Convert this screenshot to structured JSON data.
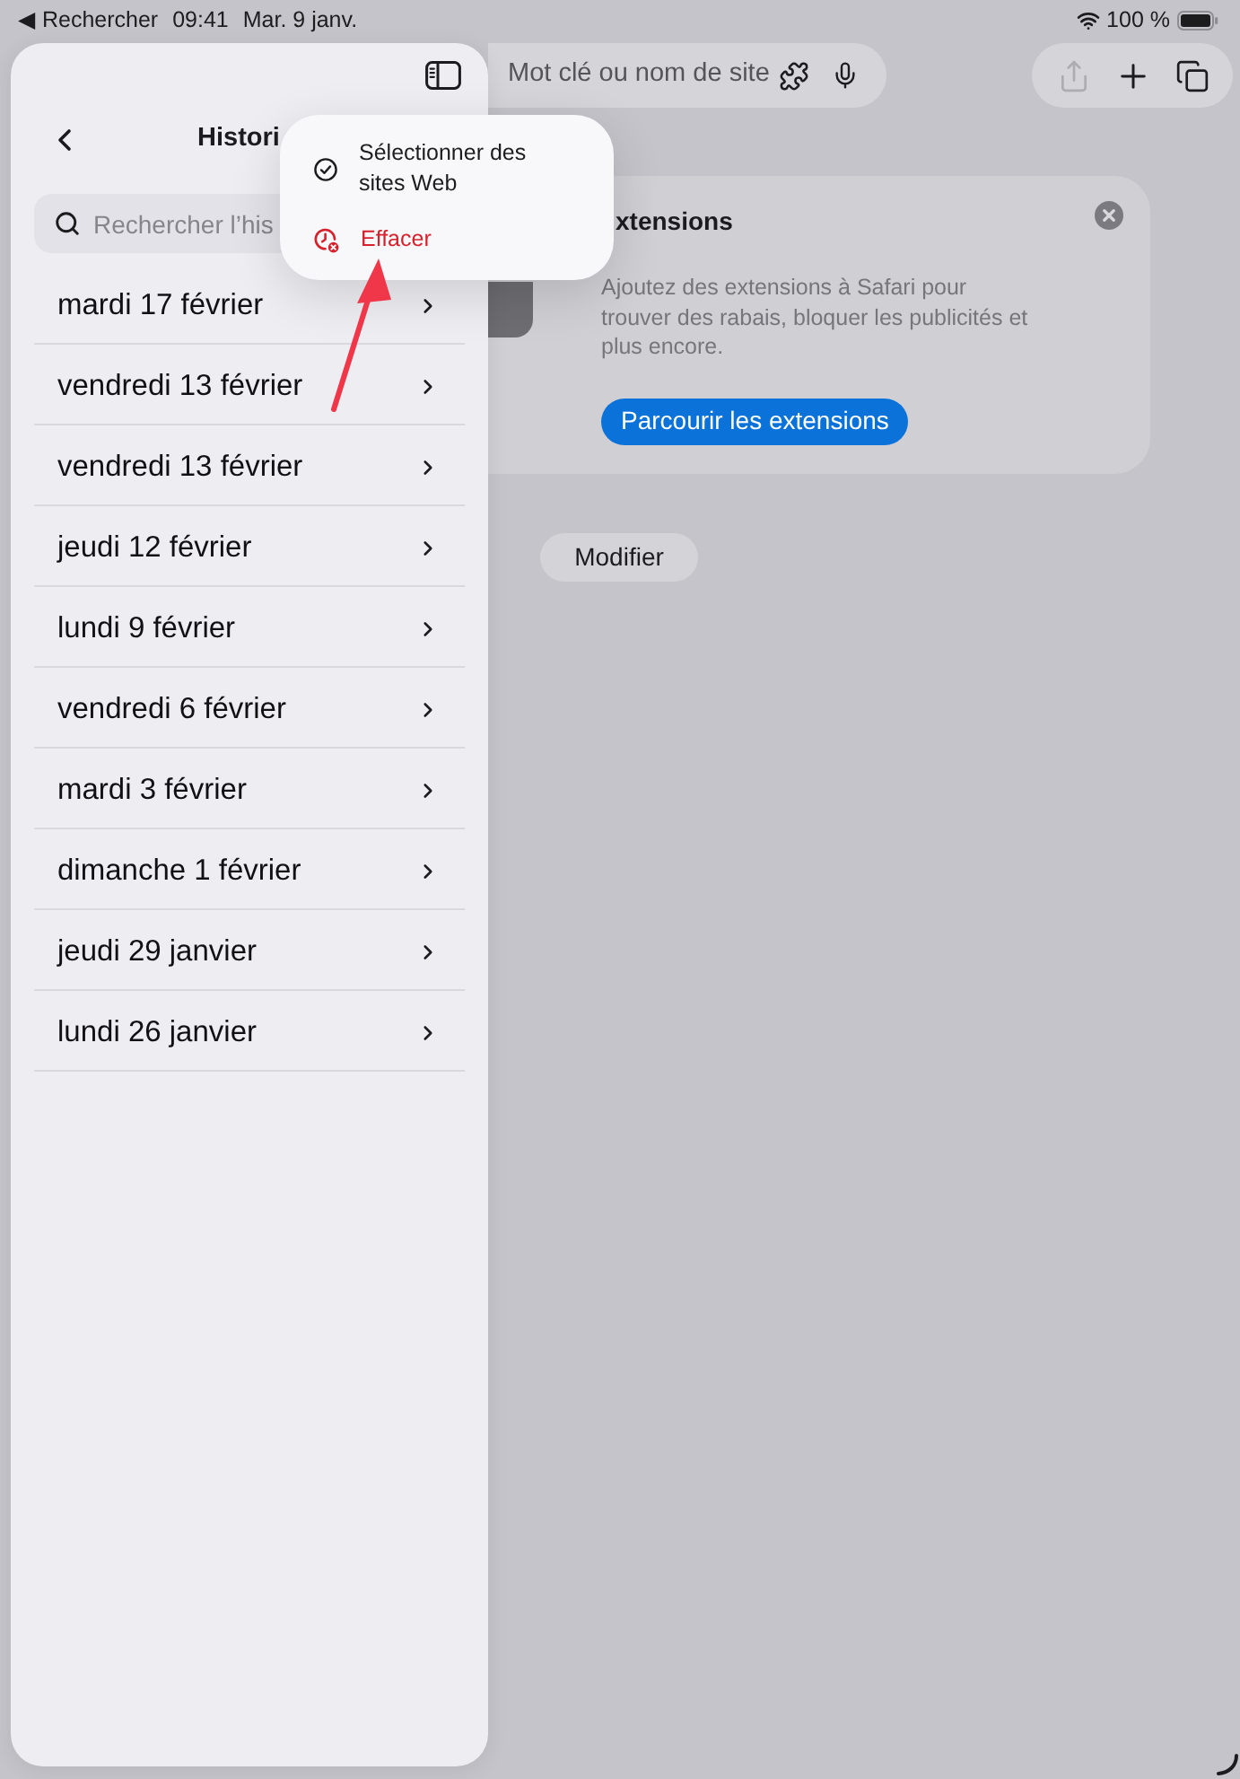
{
  "status_bar": {
    "back_link": "◀ Rechercher",
    "time": "09:41",
    "date": "Mar. 9 janv.",
    "battery_percent": "100 %"
  },
  "address_bar": {
    "placeholder": "Mot clé ou nom de site"
  },
  "toolbar_buttons": [
    {
      "kind": "share",
      "disabled": true
    },
    {
      "kind": "new_tab",
      "disabled": false
    },
    {
      "kind": "tabs",
      "disabled": false
    }
  ],
  "extensions_card": {
    "title": "xtensions",
    "description_lines": [
      "Ajoutez des extensions à Safari pour",
      "trouver des rabais, bloquer les publicités et",
      "plus encore."
    ],
    "button": "Parcourir les extensions"
  },
  "edit_button": "Modifier",
  "history_panel": {
    "title": "Histori",
    "search": {
      "placeholder": "Rechercher l’his"
    },
    "days": [
      "mardi 17 février",
      "vendredi 13 février",
      "vendredi 13 février",
      "jeudi 12 février",
      "lundi 9 février",
      "vendredi 6 février",
      "mardi 3 février",
      "dimanche 1 février",
      "jeudi 29 janvier",
      "lundi 26 janvier"
    ]
  },
  "menu": {
    "items": [
      {
        "kind": "select",
        "label": "Sélectionner des sites Web",
        "destructive": false
      },
      {
        "kind": "clear",
        "label": "Effacer",
        "destructive": true
      }
    ]
  }
}
